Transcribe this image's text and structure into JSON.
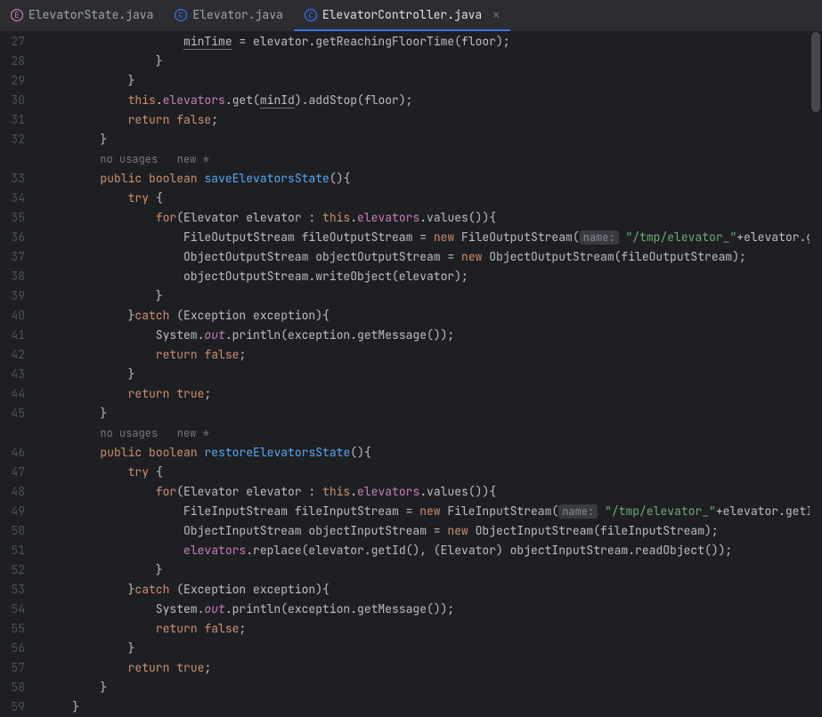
{
  "tabs": [
    {
      "label": "ElevatorState.java",
      "iconLetter": "E",
      "active": false
    },
    {
      "label": "Elevator.java",
      "iconLetter": "C",
      "active": false
    },
    {
      "label": "ElevatorController.java",
      "iconLetter": "C",
      "active": true
    }
  ],
  "lineStart": 27,
  "lineEnd": 59,
  "hints": {
    "noUsages": "no usages",
    "newStar": "new *"
  },
  "code": {
    "minTime": "minTime",
    "eq": " = ",
    "elevator": "elevator",
    "getReachingFloorTime": ".getReachingFloorTime(floor);",
    "closeBrace": "}",
    "thisDot": "this",
    "elevatorsField": "elevators",
    "get": ".get(",
    "minId": "minId",
    "addStop": ").addStop(floor);",
    "returnFalse": "return",
    "falseKw": "false",
    "trueKw": "true",
    "semicolon": ";",
    "public": "public",
    "boolean": "boolean",
    "saveElevatorsState": "saveElevatorsState",
    "restoreElevatorsState": "restoreElevatorsState",
    "parensBrace": "(){",
    "tryOpen": "try",
    "openBrace": " {",
    "for": "for",
    "forHead": "(Elevator elevator : ",
    "valuesCall": ".values()){",
    "FileOutputStream": "FileOutputStream fileOutputStream = ",
    "FileInputStream": "FileInputStream fileInputStream = ",
    "new": "new",
    "FileOutputStreamCtor": " FileOutputStream(",
    "FileInputStreamCtor": " FileInputStream(",
    "nameHint": "name:",
    "pathStr": "\"/tmp/elevator_\"",
    "plusElevGet": "+elevator.get",
    "plusElevGetId": "+elevator.getId(",
    "ObjectOutputStream": "ObjectOutputStream objectOutputStream = ",
    "ObjectInputStream": "ObjectInputStream objectInputStream = ",
    "OOSctor": " ObjectOutputStream(fileOutputStream);",
    "OISctor": " ObjectInputStream(fileInputStream);",
    "writeObject": "objectOutputStream.writeObject(elevator);",
    "replace": ".replace(elevator.getId(), (Elevator) objectInputStream.readObject());",
    "catch": "catch",
    "catchHead": " (Exception exception){",
    "System": "System.",
    "out": "out",
    "println": ".println(exception.getMessage());",
    "closeTryBrace": "}"
  }
}
